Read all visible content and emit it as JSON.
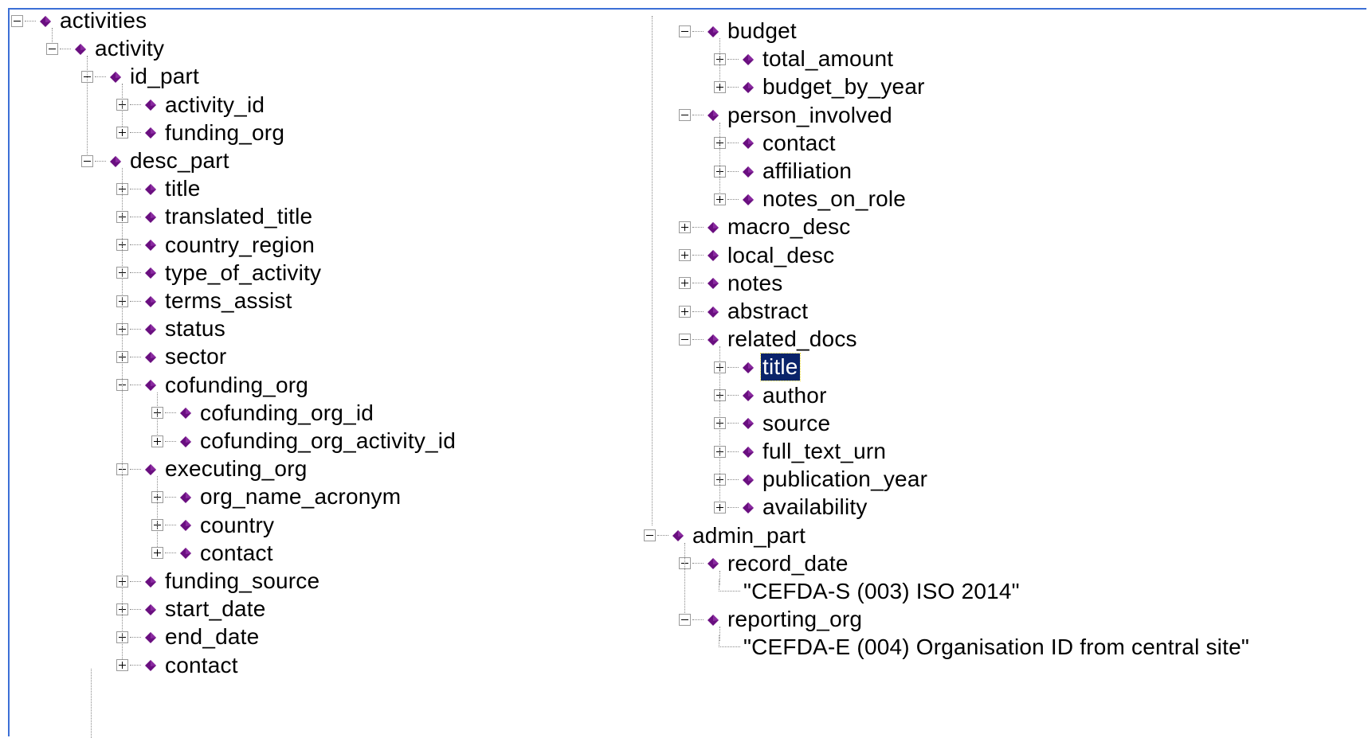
{
  "tree_left": [
    {
      "label": "activities",
      "toggle": "minus"
    },
    {
      "label": "activity",
      "toggle": "minus"
    },
    {
      "label": "id_part",
      "toggle": "minus"
    },
    {
      "label": "activity_id",
      "toggle": "plus"
    },
    {
      "label": "funding_org",
      "toggle": "plus"
    },
    {
      "label": "desc_part",
      "toggle": "minus"
    },
    {
      "label": "title",
      "toggle": "plus"
    },
    {
      "label": "translated_title",
      "toggle": "plus"
    },
    {
      "label": "country_region",
      "toggle": "plus"
    },
    {
      "label": "type_of_activity",
      "toggle": "plus"
    },
    {
      "label": "terms_assist",
      "toggle": "plus"
    },
    {
      "label": "status",
      "toggle": "plus"
    },
    {
      "label": "sector",
      "toggle": "plus"
    },
    {
      "label": "cofunding_org",
      "toggle": "minus"
    },
    {
      "label": "cofunding_org_id",
      "toggle": "plus"
    },
    {
      "label": "cofunding_org_activity_id",
      "toggle": "plus"
    },
    {
      "label": "executing_org",
      "toggle": "minus"
    },
    {
      "label": "org_name_acronym",
      "toggle": "plus"
    },
    {
      "label": "country",
      "toggle": "plus"
    },
    {
      "label": "contact",
      "toggle": "plus"
    },
    {
      "label": "funding_source",
      "toggle": "plus"
    },
    {
      "label": "start_date",
      "toggle": "plus"
    },
    {
      "label": "end_date",
      "toggle": "plus"
    },
    {
      "label": "contact",
      "toggle": "plus"
    }
  ],
  "tree_right": [
    {
      "label": "budget",
      "toggle": "minus"
    },
    {
      "label": "total_amount",
      "toggle": "plus"
    },
    {
      "label": "budget_by_year",
      "toggle": "plus"
    },
    {
      "label": "person_involved",
      "toggle": "minus"
    },
    {
      "label": "contact",
      "toggle": "plus"
    },
    {
      "label": "affiliation",
      "toggle": "plus"
    },
    {
      "label": "notes_on_role",
      "toggle": "plus"
    },
    {
      "label": "macro_desc",
      "toggle": "plus"
    },
    {
      "label": "local_desc",
      "toggle": "plus"
    },
    {
      "label": "notes",
      "toggle": "plus"
    },
    {
      "label": "abstract",
      "toggle": "plus"
    },
    {
      "label": "related_docs",
      "toggle": "minus"
    },
    {
      "label": "title",
      "toggle": "plus",
      "selected": true
    },
    {
      "label": "author",
      "toggle": "plus"
    },
    {
      "label": "source",
      "toggle": "plus"
    },
    {
      "label": "full_text_urn",
      "toggle": "plus"
    },
    {
      "label": "publication_year",
      "toggle": "plus"
    },
    {
      "label": "availability",
      "toggle": "plus"
    },
    {
      "label": "admin_part",
      "toggle": "minus"
    },
    {
      "label": "record_date",
      "toggle": "minus"
    },
    {
      "label": "\"CEFDA-S (003) ISO 2014\"",
      "toggle": "none"
    },
    {
      "label": "reporting_org",
      "toggle": "minus"
    },
    {
      "label": "\"CEFDA-E (004) Organisation ID from central site\"",
      "toggle": "none"
    }
  ],
  "colors": {
    "element_icon": "#6a0f80",
    "selection_bg": "#0a246a",
    "frame": "#3c6fd6"
  },
  "icon_names": {
    "element": "diamond-element-icon",
    "expand": "plus-box-icon",
    "collapse": "minus-box-icon"
  }
}
